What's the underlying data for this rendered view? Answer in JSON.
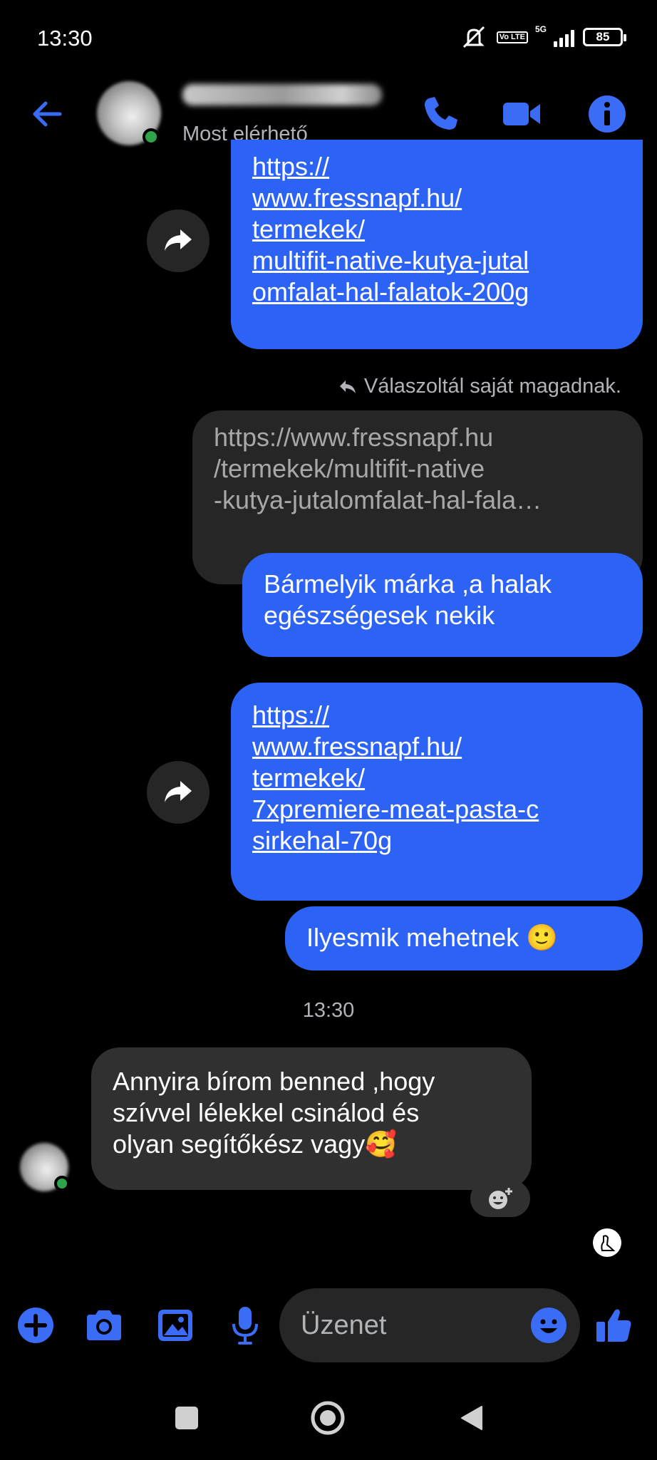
{
  "status_bar": {
    "time": "13:30",
    "volte": "Vo LTE",
    "network": "5G",
    "battery": "85"
  },
  "header": {
    "contact_status": "Most elérhető"
  },
  "messages": {
    "link1": [
      "https://",
      "www.fressnapf.hu/",
      "termekek/",
      "multifit-native-kutya-jutal",
      "omfalat-hal-falatok-200g"
    ],
    "reply_note": "Válaszoltál saját magadnak.",
    "quoted": [
      "https://www.fressnapf.hu",
      "/termekek/multifit-native",
      "-kutya-jutalomfalat-hal-fala…"
    ],
    "reply_text": [
      "Bármelyik márka ,a halak",
      "egészségesek nekik"
    ],
    "link2": [
      "https://",
      "www.fressnapf.hu/",
      "termekek/",
      "7xpremiere-meat-pasta-c",
      "sirkehal-70g"
    ],
    "text2": "Ilyesmik mehetnek 🙂",
    "timestamp": "13:30",
    "received": [
      "Annyira bírom benned ,hogy",
      "szívvel lélekkel csinálod és",
      "olyan segítőkész vagy🥰"
    ]
  },
  "composer": {
    "placeholder": "Üzenet"
  },
  "colors": {
    "accent": "#2d63f5",
    "icon_blue": "#3b6cf6",
    "online": "#31a24c"
  },
  "icons": [
    "back-arrow-icon",
    "phone-icon",
    "video-icon",
    "info-icon",
    "share-icon",
    "reply-icon",
    "add-reaction-icon",
    "plus-icon",
    "camera-icon",
    "gallery-icon",
    "microphone-icon",
    "emoji-icon",
    "thumbs-up-icon",
    "square-icon",
    "circle-icon",
    "triangle-icon"
  ]
}
